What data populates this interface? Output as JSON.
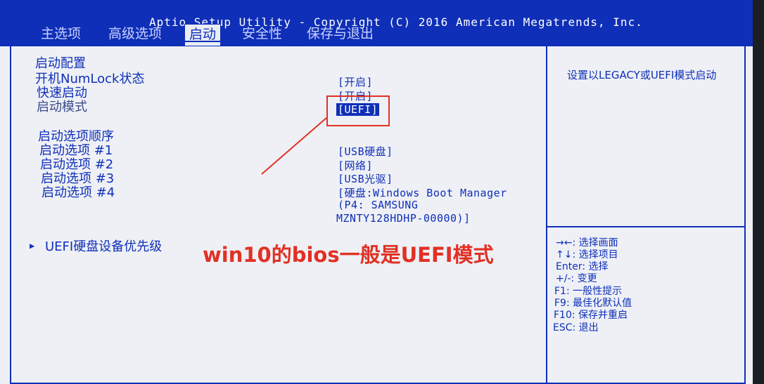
{
  "title": "Aptio Setup Utility - Copyright (C) 2016 American Megatrends, Inc.",
  "tabs": [
    {
      "label": "主选项"
    },
    {
      "label": "高级选项"
    },
    {
      "label": "启动"
    },
    {
      "label": "安全性"
    },
    {
      "label": "保存与退出"
    }
  ],
  "active_tab": "启动",
  "main": {
    "boot_config_heading": "启动配置",
    "numlock_label": "开机NumLock状态",
    "numlock_value": "[开启]",
    "fastboot_label": "快速启动",
    "fastboot_value": "[开启]",
    "bootmode_label": "启动模式",
    "bootmode_value": "[UEFI]",
    "boot_order_heading": "启动选项顺序",
    "boot_options": [
      {
        "label": "启动选项 #1",
        "value": "[USB硬盘]"
      },
      {
        "label": "启动选项 #2",
        "value": "[网络]"
      },
      {
        "label": "启动选项 #3",
        "value": "[USB光驱]"
      },
      {
        "label": "启动选项 #4",
        "value": "[硬盘:Windows Boot Manager"
      }
    ],
    "boot_option_4_line2": "(P4: SAMSUNG",
    "boot_option_4_line3": "MZNTY128HDHP-00000)]",
    "uefi_priority_label": "UEFI硬盘设备优先级"
  },
  "help": {
    "description": "设置以LEGACY或UEFI模式启动"
  },
  "keys": [
    "→←: 选择画面",
    "↑↓: 选择项目",
    "Enter: 选择",
    "+/-: 变更",
    "F1: 一般性提示",
    "F9: 最佳化默认值",
    "F10: 保存并重启",
    "ESC: 退出"
  ],
  "annotation": "win10的bios一般是UEFI模式",
  "colors": {
    "bios_blue": "#0f2fb8",
    "background": "#eef0f5",
    "annotation_red": "#e23024"
  }
}
